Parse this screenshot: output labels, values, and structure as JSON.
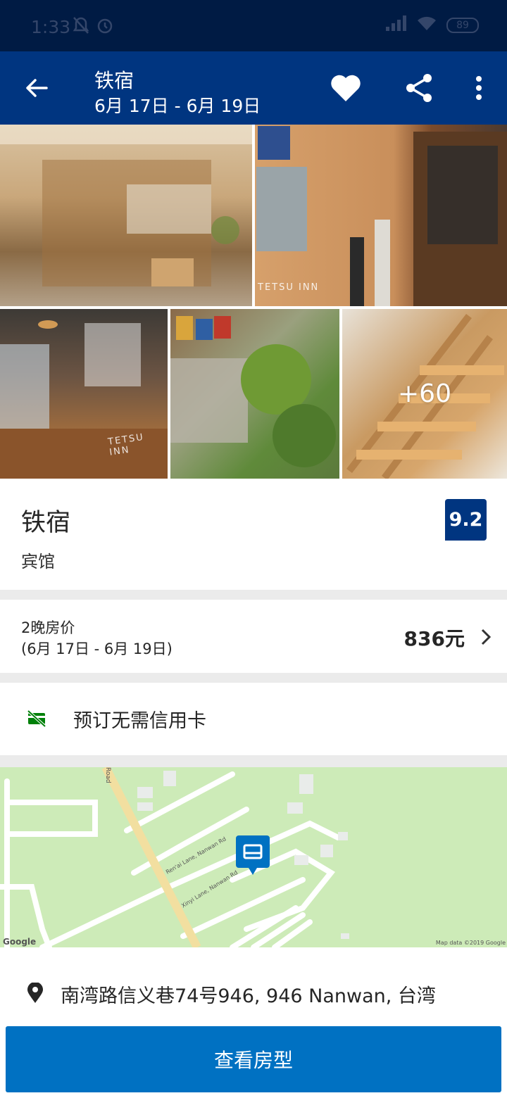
{
  "status_bar": {
    "time": "1:33",
    "battery": "89"
  },
  "header": {
    "title": "铁宿",
    "dates": "6月 17日 - 6月 19日"
  },
  "gallery": {
    "more_count": "+60",
    "watermark": "TETSU INN"
  },
  "hotel": {
    "name": "铁宿",
    "type": "宾馆",
    "score": "9.2"
  },
  "price": {
    "label": "2晚房价",
    "dates": "(6月 17日 - 6月 19日)",
    "amount": "836元"
  },
  "policy": {
    "no_card_text": "预订无需信用卡"
  },
  "map": {
    "road_label": "Road",
    "lane1": "Ren'ai Lane, Nanwan Rd",
    "lane2": "Xinyi Lane, Nanwan Rd",
    "google": "Google",
    "map_data": "Map data ©2019 Google"
  },
  "address": {
    "text": "南湾路信义巷74号946, 946 Nanwan, 台湾"
  },
  "cta": {
    "label": "查看房型"
  },
  "colors": {
    "brand_dark": "#003580",
    "status_bar": "#001b44",
    "cta": "#0071c2",
    "green": "#008009",
    "map": "#cdebb8"
  }
}
